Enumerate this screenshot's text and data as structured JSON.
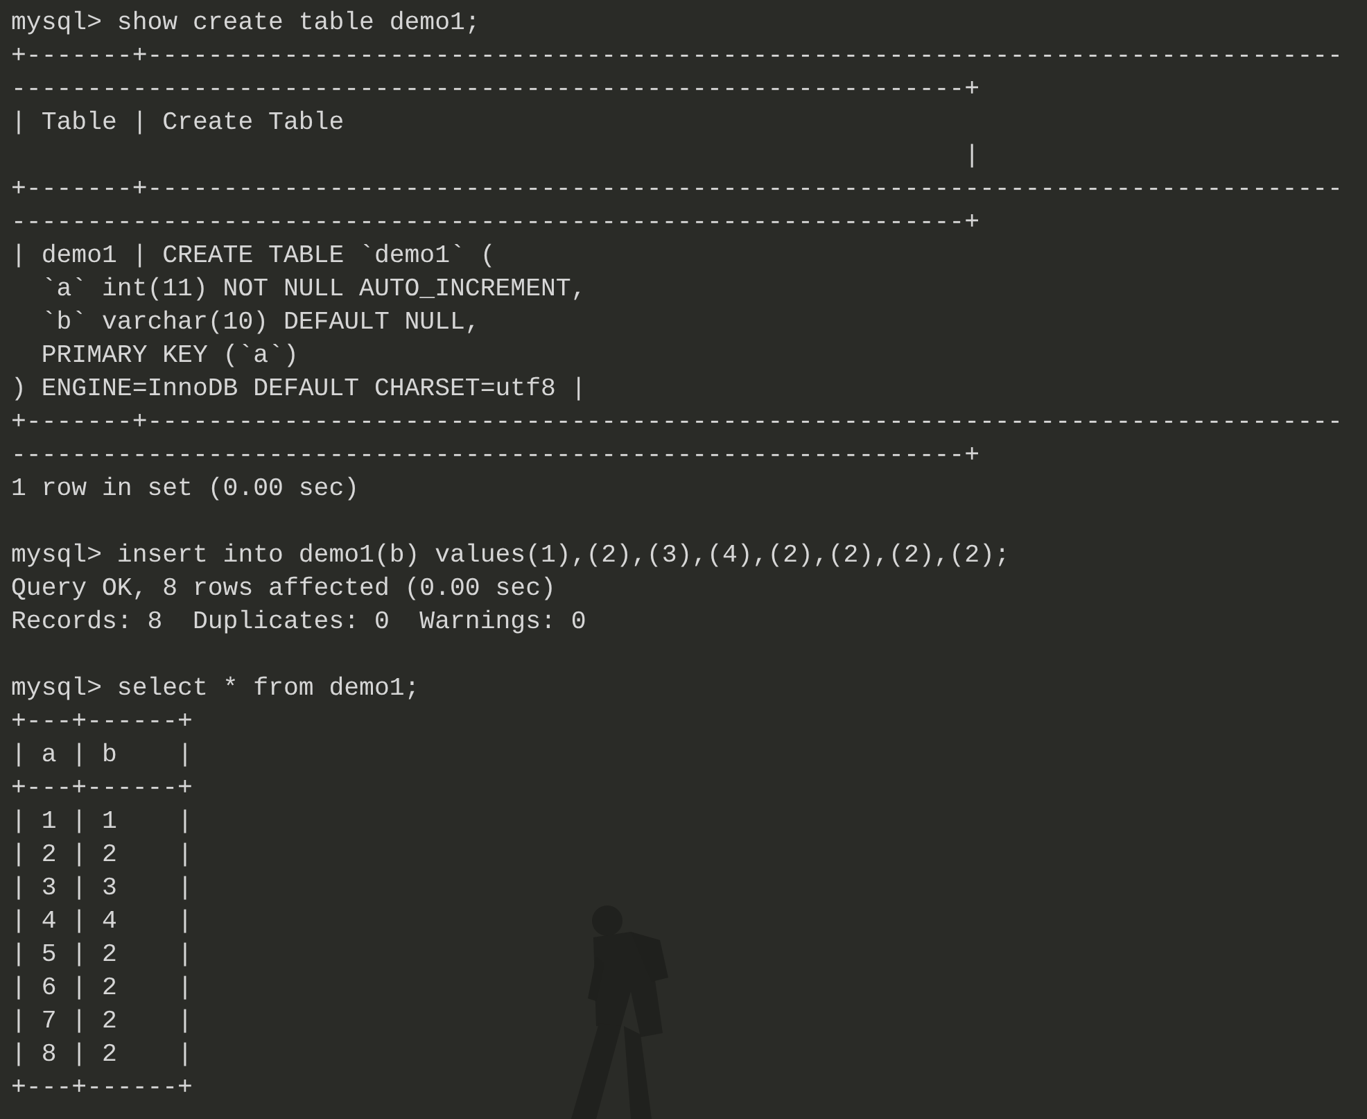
{
  "blocks": [
    {
      "lines": [
        "mysql> show create table demo1;",
        "+-------+-------------------------------------------------------------------------------",
        "---------------------------------------------------------------+",
        "| Table | Create Table",
        "                                                               |",
        "+-------+-------------------------------------------------------------------------------",
        "---------------------------------------------------------------+",
        "| demo1 | CREATE TABLE `demo1` (",
        "  `a` int(11) NOT NULL AUTO_INCREMENT,",
        "  `b` varchar(10) DEFAULT NULL,",
        "  PRIMARY KEY (`a`)",
        ") ENGINE=InnoDB DEFAULT CHARSET=utf8 |",
        "+-------+-------------------------------------------------------------------------------",
        "---------------------------------------------------------------+",
        "1 row in set (0.00 sec)"
      ]
    },
    {
      "lines": [
        "mysql> insert into demo1(b) values(1),(2),(3),(4),(2),(2),(2),(2);",
        "Query OK, 8 rows affected (0.00 sec)",
        "Records: 8  Duplicates: 0  Warnings: 0"
      ]
    },
    {
      "lines": [
        "mysql> select * from demo1;",
        "+---+------+",
        "| a | b    |",
        "+---+------+",
        "| 1 | 1    |",
        "| 2 | 2    |",
        "| 3 | 3    |",
        "| 4 | 4    |",
        "| 5 | 2    |",
        "| 6 | 2    |",
        "| 7 | 2    |",
        "| 8 | 2    |",
        "+---+------+"
      ]
    }
  ]
}
